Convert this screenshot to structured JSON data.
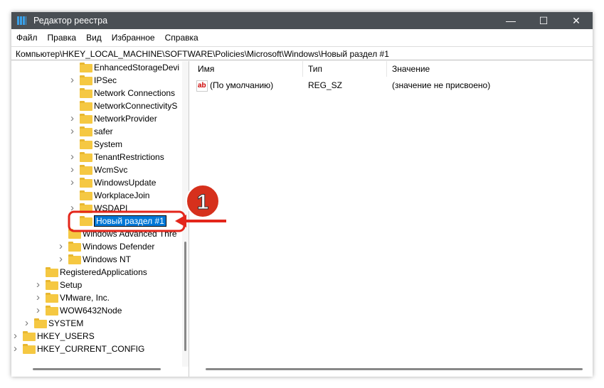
{
  "window": {
    "title": "Редактор реестра",
    "minimize": "—",
    "maximize": "☐",
    "close": "✕"
  },
  "menu": [
    "Файл",
    "Правка",
    "Вид",
    "Избранное",
    "Справка"
  ],
  "address": "Компьютер\\HKEY_LOCAL_MACHINE\\SOFTWARE\\Policies\\Microsoft\\Windows\\Новый раздел #1",
  "tree": [
    {
      "label": "EnhancedStorageDevi",
      "level": 5,
      "expandable": false
    },
    {
      "label": "IPSec",
      "level": 5,
      "expandable": true
    },
    {
      "label": "Network Connections",
      "level": 5,
      "expandable": false
    },
    {
      "label": "NetworkConnectivityS",
      "level": 5,
      "expandable": false
    },
    {
      "label": "NetworkProvider",
      "level": 5,
      "expandable": true
    },
    {
      "label": "safer",
      "level": 5,
      "expandable": true
    },
    {
      "label": "System",
      "level": 5,
      "expandable": false
    },
    {
      "label": "TenantRestrictions",
      "level": 5,
      "expandable": true
    },
    {
      "label": "WcmSvc",
      "level": 5,
      "expandable": true
    },
    {
      "label": "WindowsUpdate",
      "level": 5,
      "expandable": true
    },
    {
      "label": "WorkplaceJoin",
      "level": 5,
      "expandable": false
    },
    {
      "label": "WSDAPI",
      "level": 5,
      "expandable": true
    },
    {
      "label": "Новый раздел #1",
      "level": 5,
      "expandable": false,
      "editing": true
    },
    {
      "label": "Windows Advanced Thre",
      "level": 4,
      "expandable": false
    },
    {
      "label": "Windows Defender",
      "level": 4,
      "expandable": true
    },
    {
      "label": "Windows NT",
      "level": 4,
      "expandable": true
    },
    {
      "label": "RegisteredApplications",
      "level": 2,
      "expandable": false
    },
    {
      "label": "Setup",
      "level": 2,
      "expandable": true
    },
    {
      "label": "VMware, Inc.",
      "level": 2,
      "expandable": true
    },
    {
      "label": "WOW6432Node",
      "level": 2,
      "expandable": true
    },
    {
      "label": "SYSTEM",
      "level": 1,
      "expandable": true
    },
    {
      "label": "HKEY_USERS",
      "level": 0,
      "expandable": true
    },
    {
      "label": "HKEY_CURRENT_CONFIG",
      "level": 0,
      "expandable": true
    }
  ],
  "columns": {
    "name": "Имя",
    "type": "Тип",
    "value": "Значение"
  },
  "values": [
    {
      "icon": "ab",
      "name": "(По умолчанию)",
      "type": "REG_SZ",
      "data": "(значение не присвоено)"
    }
  ],
  "annotation": {
    "badge": "1",
    "color": "#e3261b"
  }
}
